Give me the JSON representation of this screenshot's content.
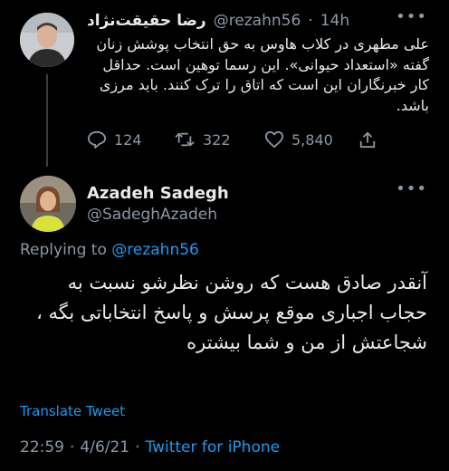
{
  "tweet1": {
    "display_name": "رضا حقیقت‌نژاد",
    "handle": "@rezahn56",
    "separator": "·",
    "time": "14h",
    "more": "•••",
    "body": "علی مطهری در کلاب هاوس به حق انتخاب پوشش زنان گفته «استعداد حیوانی». این رسما توهین است. حداقل کار خبرنگاران این است که اتاق را ترک کنند. باید مرزی باشد.",
    "actions": {
      "replies": "124",
      "retweets": "322",
      "likes": "5,840"
    }
  },
  "tweet2": {
    "display_name": "Azadeh Sadegh",
    "handle": "@SadeghAzadeh",
    "more": "•••",
    "replying_prefix": "Replying to",
    "replying_to": "@rezahn56",
    "body": "آنقدر صادق هست که روشن نظرشو نسبت به حجاب اجباری موقع پرسش و پاسخ انتخاباتی بگه ، شجاعتش از من و شما بیشتره",
    "translate_label": "Translate Tweet",
    "time": "22:59",
    "dot1": "·",
    "date": "4/6/21",
    "dot2": "·",
    "source": "Twitter for iPhone"
  },
  "colors": {
    "background": "#000000",
    "text": "#e7e9ea",
    "muted": "#8b98a5",
    "link": "#1d9bf0"
  },
  "icons": [
    "reply-icon",
    "retweet-icon",
    "like-icon",
    "share-icon"
  ]
}
